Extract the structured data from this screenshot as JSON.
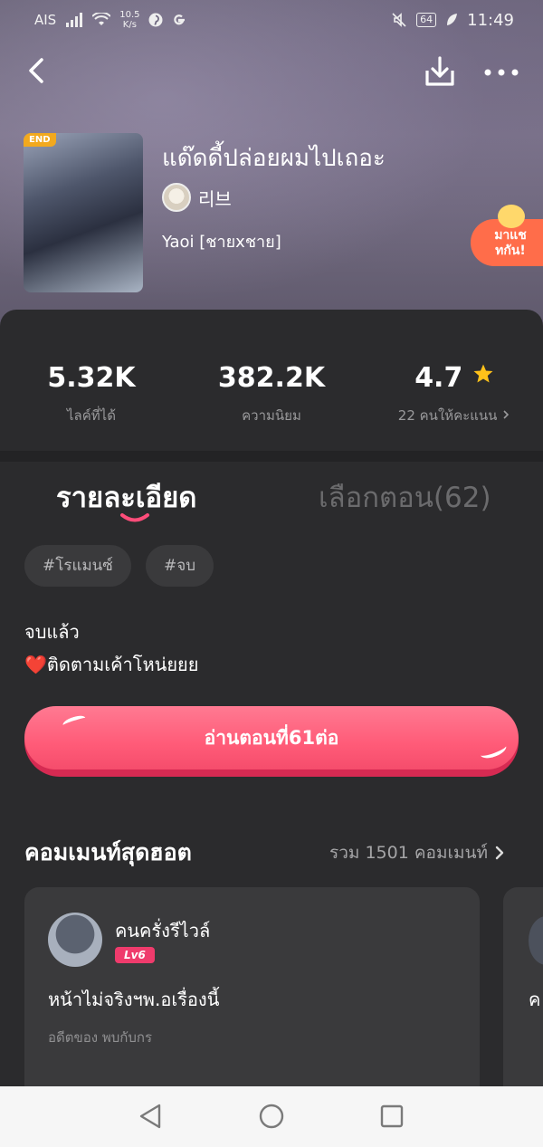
{
  "status_bar": {
    "carrier": "AIS",
    "net_speed_value": "10.5",
    "net_speed_unit": "K/s",
    "battery": "64",
    "time": "11:49"
  },
  "book": {
    "cover_badge": "END",
    "title": "แด๊ดดี้ปล่อยผมไปเถอะ",
    "author": "리브",
    "genre": "Yaoi [ชายxชาย]"
  },
  "chat_bubble": {
    "line1": "มาแช",
    "line2": "ทกัน!"
  },
  "stats": [
    {
      "value": "5.32K",
      "label": "ไลค์ที่ได้"
    },
    {
      "value": "382.2K",
      "label": "ความนิยม"
    },
    {
      "value": "4.7",
      "label": "22 คนให้คะแนน"
    }
  ],
  "tabs": {
    "details": "รายละเอียด",
    "episodes": "เลือกตอน(62)"
  },
  "tags": [
    "#โรแมนซ์",
    "#จบ"
  ],
  "description": {
    "status": "จบแล้ว",
    "follow": "❤️ติดตามเค้าโหน่ยยย"
  },
  "read_button": "อ่านตอนที่61ต่อ",
  "hot_comments": {
    "title": "คอมเมนท์สุดฮอต",
    "total": "รวม 1501 คอมเมนท์",
    "items": [
      {
        "user": "คนครั่งรีไวล์",
        "level": "Lv6",
        "text": "หน้าไม่จริงฯพ.อเรื่องนี้",
        "source": "อดีตของ พบกับกร"
      },
      {
        "text": "ค"
      }
    ]
  },
  "colors": {
    "accent": "#ff5b78",
    "star": "#ffc21a",
    "level_badge": "#ef3b6c",
    "chat_bubble": "#ff6d4a"
  },
  "icons": {
    "back": "chevron-left-icon",
    "download": "download-icon",
    "more": "more-horizontal-icon",
    "star": "star-icon",
    "chevron_right": "chevron-right-icon"
  }
}
